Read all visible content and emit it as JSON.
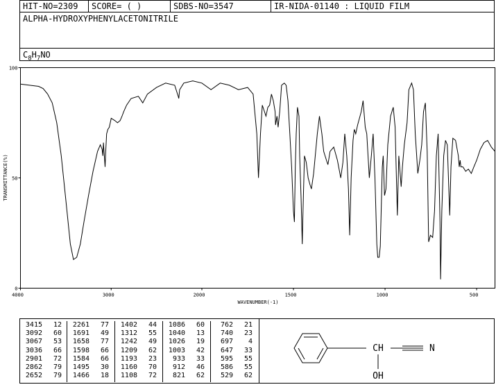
{
  "header": {
    "hit_no": "HIT-NO=2309",
    "score": "SCORE=  (   )",
    "sdbs_no": "SDBS-NO=3547",
    "ir_code": "IR-NIDA-01140 : LIQUID FILM",
    "compound_name": "ALPHA-HYDROXYPHENYLACETONITRILE",
    "formula_parts": [
      "C",
      "8",
      "H",
      "7",
      "NO"
    ]
  },
  "chart_data": {
    "type": "line",
    "title": "",
    "xlabel": "WAVENUMBER(-1)",
    "ylabel": "TRANSMITTANCE(%)",
    "xlim": [
      4000,
      400
    ],
    "ylim": [
      0,
      100
    ],
    "x_ticks": [
      4000,
      3000,
      2000,
      1500,
      1000,
      500
    ],
    "y_ticks": [
      0,
      50,
      100
    ],
    "series": [
      {
        "name": "",
        "points": [
          [
            4000,
            92.5
          ],
          [
            3900,
            92
          ],
          [
            3800,
            91.5
          ],
          [
            3750,
            90.5
          ],
          [
            3700,
            88
          ],
          [
            3650,
            84
          ],
          [
            3600,
            75
          ],
          [
            3550,
            60
          ],
          [
            3500,
            40
          ],
          [
            3450,
            20
          ],
          [
            3416,
            13
          ],
          [
            3380,
            14
          ],
          [
            3340,
            20
          ],
          [
            3300,
            30
          ],
          [
            3250,
            42
          ],
          [
            3200,
            53
          ],
          [
            3150,
            62
          ],
          [
            3120,
            65
          ],
          [
            3100,
            63
          ],
          [
            3092,
            60
          ],
          [
            3085,
            66
          ],
          [
            3075,
            60
          ],
          [
            3067,
            55
          ],
          [
            3060,
            62
          ],
          [
            3050,
            70
          ],
          [
            3036,
            72
          ],
          [
            3020,
            73
          ],
          [
            3000,
            77
          ],
          [
            2960,
            76
          ],
          [
            2930,
            75
          ],
          [
            2901,
            76
          ],
          [
            2880,
            78
          ],
          [
            2862,
            80
          ],
          [
            2830,
            83
          ],
          [
            2780,
            86
          ],
          [
            2700,
            87
          ],
          [
            2652,
            84
          ],
          [
            2600,
            88
          ],
          [
            2500,
            91
          ],
          [
            2400,
            93
          ],
          [
            2300,
            92
          ],
          [
            2261,
            87
          ],
          [
            2255,
            86
          ],
          [
            2245,
            90
          ],
          [
            2200,
            93
          ],
          [
            2100,
            94
          ],
          [
            2000,
            93
          ],
          [
            1950,
            90
          ],
          [
            1900,
            93
          ],
          [
            1850,
            92
          ],
          [
            1800,
            90
          ],
          [
            1750,
            91
          ],
          [
            1720,
            88
          ],
          [
            1700,
            70
          ],
          [
            1691,
            50
          ],
          [
            1680,
            70
          ],
          [
            1670,
            83
          ],
          [
            1658,
            80
          ],
          [
            1650,
            78
          ],
          [
            1640,
            82
          ],
          [
            1630,
            83
          ],
          [
            1620,
            88
          ],
          [
            1610,
            85
          ],
          [
            1600,
            80
          ],
          [
            1598,
            74
          ],
          [
            1590,
            78
          ],
          [
            1584,
            73
          ],
          [
            1575,
            80
          ],
          [
            1565,
            92
          ],
          [
            1550,
            93
          ],
          [
            1540,
            92
          ],
          [
            1530,
            85
          ],
          [
            1520,
            70
          ],
          [
            1510,
            55
          ],
          [
            1500,
            35
          ],
          [
            1495,
            30
          ],
          [
            1490,
            55
          ],
          [
            1485,
            70
          ],
          [
            1478,
            82
          ],
          [
            1470,
            78
          ],
          [
            1466,
            60
          ],
          [
            1458,
            40
          ],
          [
            1452,
            20
          ],
          [
            1448,
            35
          ],
          [
            1440,
            60
          ],
          [
            1430,
            57
          ],
          [
            1420,
            50
          ],
          [
            1410,
            47
          ],
          [
            1402,
            45
          ],
          [
            1390,
            52
          ],
          [
            1370,
            70
          ],
          [
            1358,
            78
          ],
          [
            1345,
            70
          ],
          [
            1335,
            62
          ],
          [
            1320,
            58
          ],
          [
            1312,
            56
          ],
          [
            1300,
            62
          ],
          [
            1280,
            64
          ],
          [
            1260,
            58
          ],
          [
            1242,
            50
          ],
          [
            1230,
            57
          ],
          [
            1220,
            70
          ],
          [
            1209,
            60
          ],
          [
            1200,
            45
          ],
          [
            1193,
            24
          ],
          [
            1185,
            50
          ],
          [
            1175,
            67
          ],
          [
            1168,
            72
          ],
          [
            1160,
            70
          ],
          [
            1150,
            74
          ],
          [
            1130,
            80
          ],
          [
            1120,
            85
          ],
          [
            1108,
            73
          ],
          [
            1100,
            70
          ],
          [
            1086,
            50
          ],
          [
            1075,
            60
          ],
          [
            1065,
            70
          ],
          [
            1055,
            50
          ],
          [
            1045,
            20
          ],
          [
            1040,
            14
          ],
          [
            1032,
            14
          ],
          [
            1026,
            19
          ],
          [
            1015,
            55
          ],
          [
            1010,
            60
          ],
          [
            1003,
            42
          ],
          [
            995,
            45
          ],
          [
            985,
            65
          ],
          [
            970,
            78
          ],
          [
            955,
            82
          ],
          [
            945,
            73
          ],
          [
            933,
            33
          ],
          [
            925,
            60
          ],
          [
            912,
            46
          ],
          [
            905,
            55
          ],
          [
            895,
            65
          ],
          [
            880,
            75
          ],
          [
            870,
            90
          ],
          [
            855,
            93
          ],
          [
            845,
            90
          ],
          [
            835,
            70
          ],
          [
            821,
            52
          ],
          [
            810,
            58
          ],
          [
            800,
            65
          ],
          [
            790,
            80
          ],
          [
            780,
            84
          ],
          [
            770,
            62
          ],
          [
            762,
            21
          ],
          [
            752,
            24
          ],
          [
            740,
            23
          ],
          [
            730,
            35
          ],
          [
            720,
            60
          ],
          [
            710,
            70
          ],
          [
            700,
            30
          ],
          [
            697,
            4
          ],
          [
            690,
            35
          ],
          [
            680,
            60
          ],
          [
            670,
            67
          ],
          [
            660,
            65
          ],
          [
            647,
            33
          ],
          [
            640,
            55
          ],
          [
            630,
            68
          ],
          [
            615,
            67
          ],
          [
            600,
            60
          ],
          [
            595,
            55
          ],
          [
            590,
            58
          ],
          [
            586,
            55
          ],
          [
            575,
            55
          ],
          [
            560,
            53
          ],
          [
            545,
            54
          ],
          [
            529,
            52
          ],
          [
            515,
            55
          ],
          [
            500,
            58
          ],
          [
            480,
            63
          ],
          [
            460,
            66
          ],
          [
            440,
            67
          ],
          [
            420,
            64
          ],
          [
            400,
            62
          ]
        ]
      }
    ]
  },
  "peak_table": {
    "columns": [
      [
        [
          "3415",
          "12"
        ],
        [
          "3092",
          "60"
        ],
        [
          "3067",
          "53"
        ],
        [
          "3036",
          "66"
        ],
        [
          "2901",
          "72"
        ],
        [
          "2862",
          "79"
        ],
        [
          "2652",
          "79"
        ]
      ],
      [
        [
          "2261",
          "77"
        ],
        [
          "1691",
          "49"
        ],
        [
          "1658",
          "77"
        ],
        [
          "1598",
          "66"
        ],
        [
          "1584",
          "66"
        ],
        [
          "1495",
          "30"
        ],
        [
          "1466",
          "18"
        ]
      ],
      [
        [
          "1402",
          "44"
        ],
        [
          "1312",
          "55"
        ],
        [
          "1242",
          "49"
        ],
        [
          "1209",
          "62"
        ],
        [
          "1193",
          "23"
        ],
        [
          "1160",
          "70"
        ],
        [
          "1108",
          "72"
        ]
      ],
      [
        [
          "1086",
          "60"
        ],
        [
          "1040",
          "13"
        ],
        [
          "1026",
          "19"
        ],
        [
          "1003",
          "42"
        ],
        [
          "933",
          "33"
        ],
        [
          "912",
          "46"
        ],
        [
          "821",
          "62"
        ]
      ],
      [
        [
          "762",
          "21"
        ],
        [
          "740",
          "23"
        ],
        [
          "697",
          "4"
        ],
        [
          "647",
          "33"
        ],
        [
          "595",
          "55"
        ],
        [
          "586",
          "55"
        ],
        [
          "529",
          "62"
        ]
      ]
    ]
  },
  "structure": {
    "ch_label": "CH",
    "n_label": "N",
    "oh_label": "OH"
  }
}
